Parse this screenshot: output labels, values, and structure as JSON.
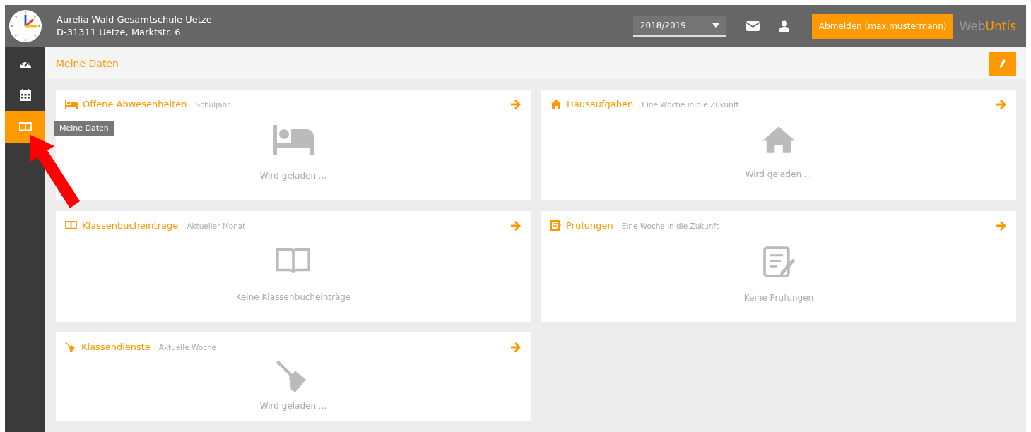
{
  "header": {
    "school_name": "Aurelia Wald Gesamtschule Uetze",
    "school_address": "D-31311 Uetze, Marktstr. 6",
    "school_year": "2018/2019",
    "logout_button": "Abmelden (max.mustermann)",
    "brand_prefix": "Web",
    "brand_suffix": "Untis"
  },
  "sidebar": {
    "items": [
      {
        "kind": "dashboard",
        "selected": false
      },
      {
        "kind": "calendar",
        "selected": false
      },
      {
        "kind": "book",
        "selected": true
      }
    ],
    "tooltip": "Meine Daten"
  },
  "page_title": "Meine Daten",
  "cards": [
    {
      "kind": "absences",
      "title": "Offene Abwesenheiten",
      "subtitle": "Schuljahr",
      "message": "Wird geladen ..."
    },
    {
      "kind": "homework",
      "title": "Hausaufgaben",
      "subtitle": "Eine Woche in die Zukunft",
      "message": "Wird geladen ..."
    },
    {
      "kind": "classbook",
      "title": "Klassenbucheinträge",
      "subtitle": "Aktueller Monat",
      "message": "Keine Klassenbucheinträge"
    },
    {
      "kind": "exams",
      "title": "Prüfungen",
      "subtitle": "Eine Woche in die Zukunft",
      "message": "Keine Prüfungen"
    },
    {
      "kind": "duties",
      "title": "Klassendienste",
      "subtitle": "Aktuelle Woche",
      "message": "Wird geladen ..."
    }
  ]
}
